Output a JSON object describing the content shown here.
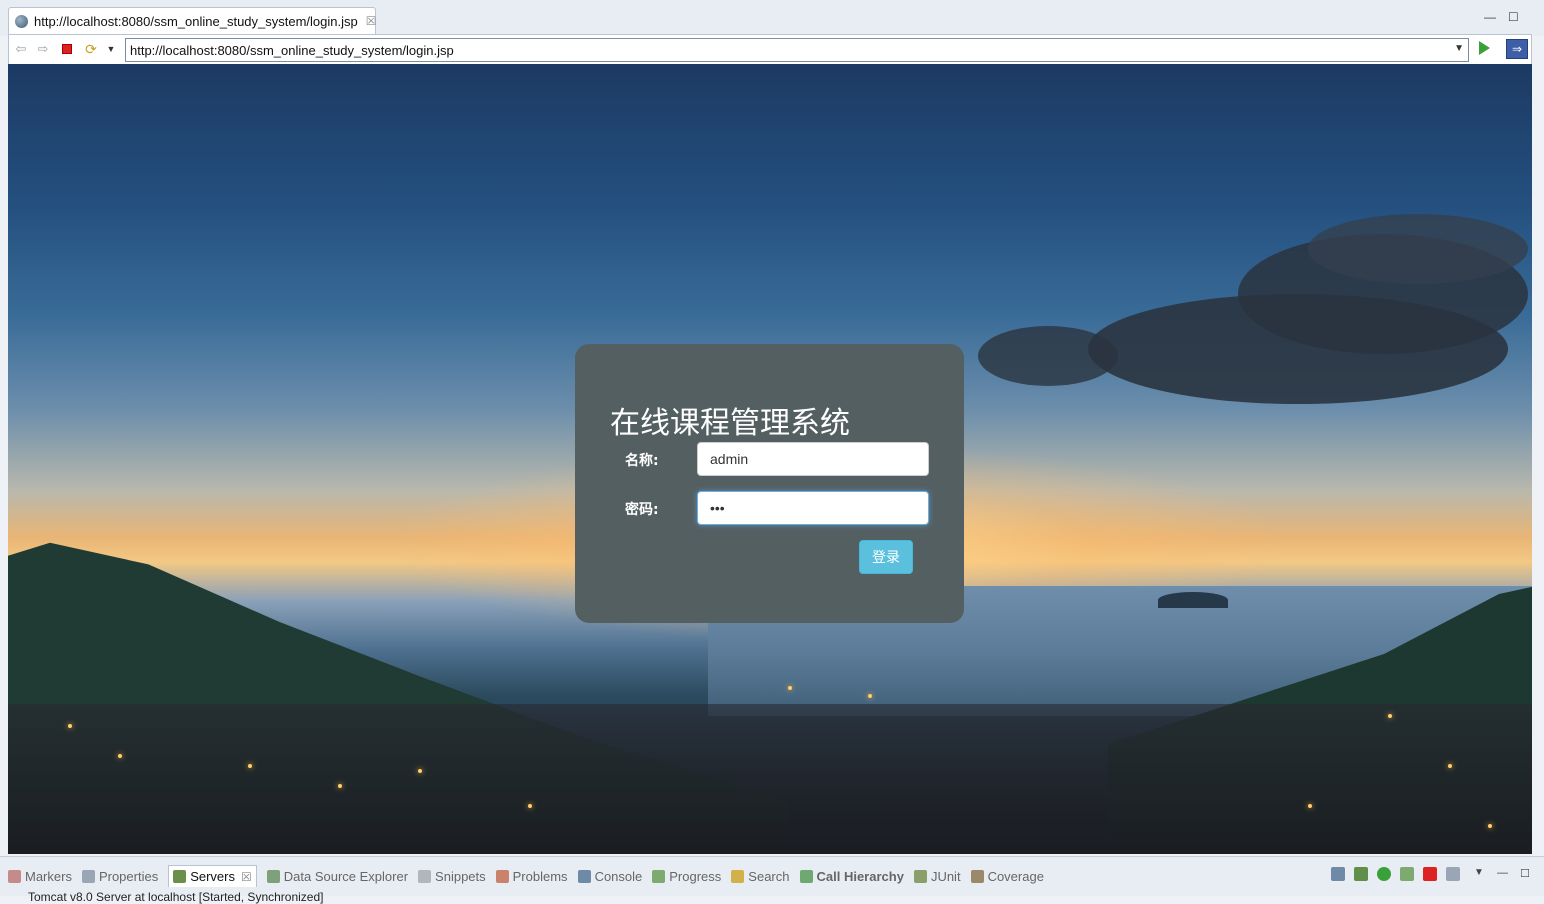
{
  "editor_tab": {
    "title": "http://localhost:8080/ssm_online_study_system/login.jsp",
    "close": "☒"
  },
  "window_controls": {
    "minimize": "—",
    "maximize": "☐"
  },
  "toolbar": {
    "url": "http://localhost:8080/ssm_online_study_system/login.jsp",
    "back_icon": "⇦",
    "forward_icon": "⇨",
    "refresh_icon": "⟳",
    "dropdown": "▼",
    "nav_icon": "⇒"
  },
  "login": {
    "title": "在线课程管理系统",
    "name_label": "名称:",
    "name_value": "admin",
    "password_label": "密码:",
    "password_value": "•••",
    "submit_label": "登录"
  },
  "views": {
    "tabs": [
      {
        "label": "Markers",
        "color": "#c58a8a"
      },
      {
        "label": "Properties",
        "color": "#9aa6b5"
      },
      {
        "label": "Servers",
        "color": "#6a8f4a",
        "active": true
      },
      {
        "label": "Data Source Explorer",
        "color": "#7ea07a"
      },
      {
        "label": "Snippets",
        "color": "#b0b6be"
      },
      {
        "label": "Problems",
        "color": "#c9826b"
      },
      {
        "label": "Console",
        "color": "#6f8aa6"
      },
      {
        "label": "Progress",
        "color": "#7caa6f"
      },
      {
        "label": "Search",
        "color": "#d2b14a"
      },
      {
        "label": "Call Hierarchy",
        "color": "#6fa870"
      },
      {
        "label": "JUnit",
        "color": "#8a9f6a"
      },
      {
        "label": "Coverage",
        "color": "#9a8a6a"
      }
    ],
    "server_row": "Tomcat v8.0 Server at localhost  [Started, Synchronized]"
  },
  "colors": {
    "panel": "#545f62",
    "button": "#5bc0de",
    "focus": "#66afe9"
  }
}
